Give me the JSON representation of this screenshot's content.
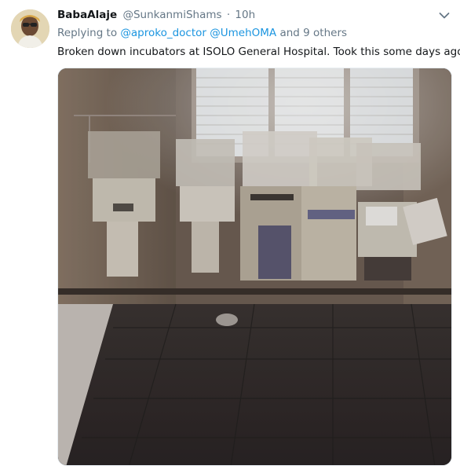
{
  "tweet": {
    "display_name": "BabaAlaje",
    "handle": "@SunkanmiShams",
    "separator": "·",
    "time": "10h",
    "reply": {
      "prefix": "Replying to",
      "mention_1": "@aproko_doctor",
      "mention_2": "@UmehOMA",
      "suffix": "and 9 others"
    },
    "text": "Broken down incubators at ISOLO General Hospital. Took this some days ago"
  },
  "icons": {
    "more": "chevron-down-icon"
  },
  "colors": {
    "link": "#1b95e0",
    "secondary_text": "#657786",
    "primary_text": "#14171a"
  }
}
